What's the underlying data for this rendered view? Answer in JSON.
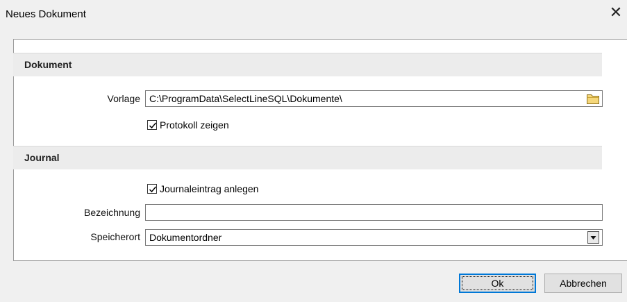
{
  "window": {
    "title": "Neues Dokument"
  },
  "dokument": {
    "header": "Dokument",
    "vorlage_label": "Vorlage",
    "vorlage_value": "C:\\ProgramData\\SelectLineSQL\\Dokumente\\",
    "protokoll_label": "Protokoll zeigen",
    "protokoll_checked": true
  },
  "journal": {
    "header": "Journal",
    "journaleintrag_label": "Journaleintrag anlegen",
    "journaleintrag_checked": true,
    "bezeichnung_label": "Bezeichnung",
    "bezeichnung_value": "",
    "speicherort_label": "Speicherort",
    "speicherort_value": "Dokumentordner"
  },
  "buttons": {
    "ok": "Ok",
    "cancel": "Abbrechen"
  },
  "icons": {
    "close": "close-icon",
    "folder": "folder-icon",
    "dropdown": "chevron-down-icon",
    "check": "check-icon"
  },
  "colors": {
    "folder": "#f5d77a",
    "focus": "#0078d7"
  }
}
